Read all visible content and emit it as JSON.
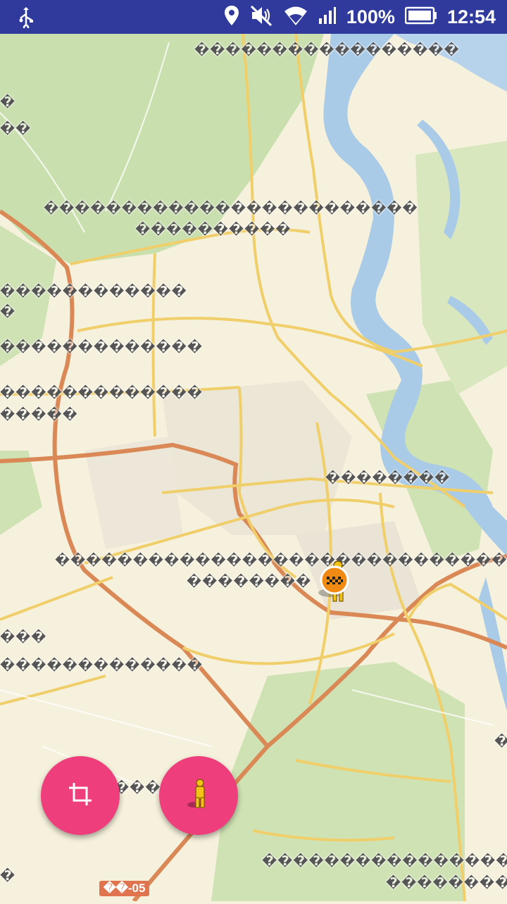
{
  "status_bar": {
    "battery": "100%",
    "time": "12:54",
    "icons": [
      "usb-icon",
      "location-icon",
      "mute-icon",
      "wifi-icon",
      "signal-icon",
      "battery-icon"
    ]
  },
  "map": {
    "labels": [
      "�����������������",
      "�",
      "��",
      "������������������������",
      "����������",
      "������������",
      "�",
      "�������������",
      "�������������",
      "�����",
      "��������",
      "������������������������������",
      "��������",
      "���",
      "�������������",
      "���",
      "�",
      "����������������",
      "���������",
      "�"
    ],
    "road_badge": "��-05"
  },
  "fabs": {
    "crop": "crop-icon",
    "pedestrian": "person-icon"
  }
}
